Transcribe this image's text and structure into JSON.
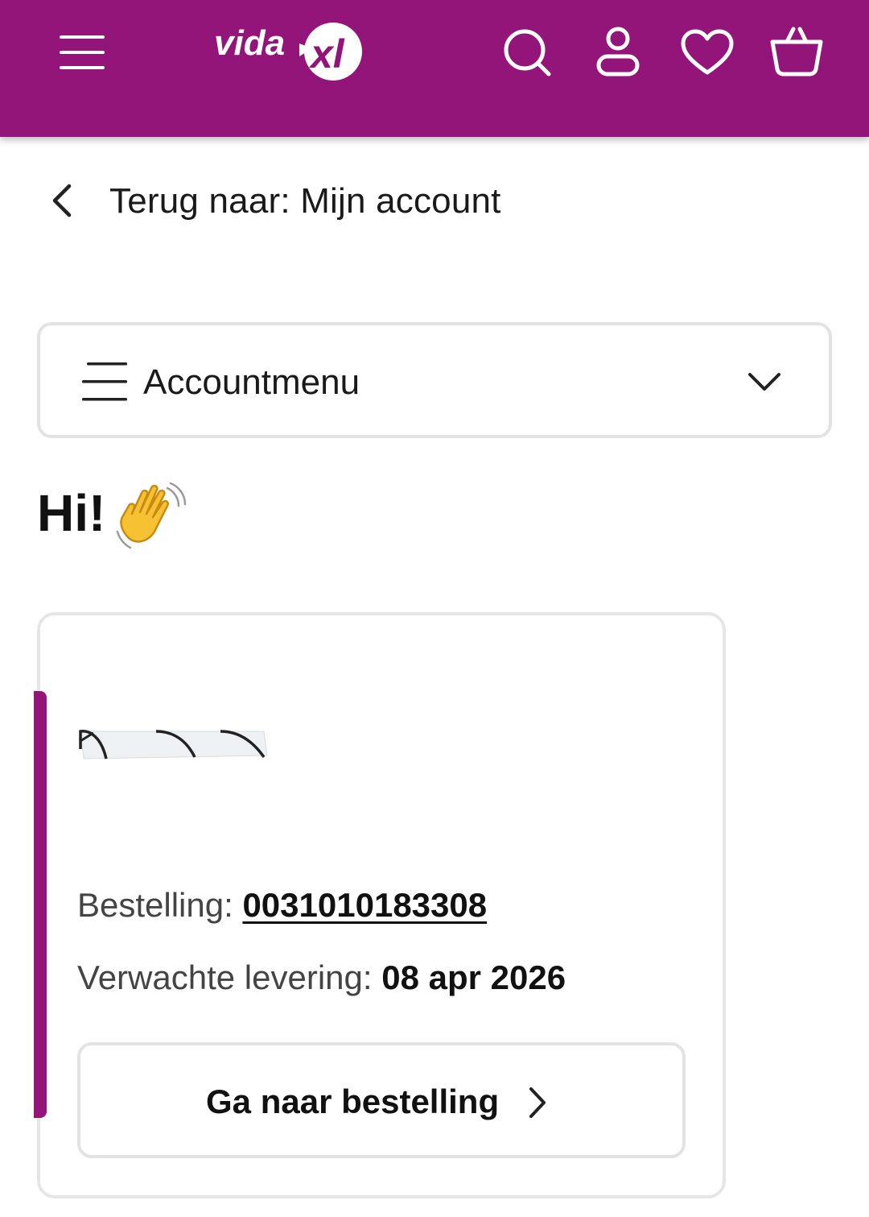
{
  "header": {
    "brand": "vidaXL",
    "brand_text_left": "vida",
    "brand_text_right": "XL",
    "icons": [
      "menu-icon",
      "search-icon",
      "user-icon",
      "heart-icon",
      "basket-icon"
    ],
    "background_color": "#94157a"
  },
  "back_link": {
    "label": "Terug naar: Mijn account"
  },
  "account_menu": {
    "label": "Accountmenu"
  },
  "greeting": {
    "text": "Hi!",
    "emoji": "waving-hand"
  },
  "order_card": {
    "order_label": "Bestelling: ",
    "order_number": "0031010183308",
    "delivery_label": "Verwachte levering: ",
    "delivery_date": "08 apr 2026",
    "button_label": "Ga naar bestelling",
    "accent_color": "#94157a"
  }
}
